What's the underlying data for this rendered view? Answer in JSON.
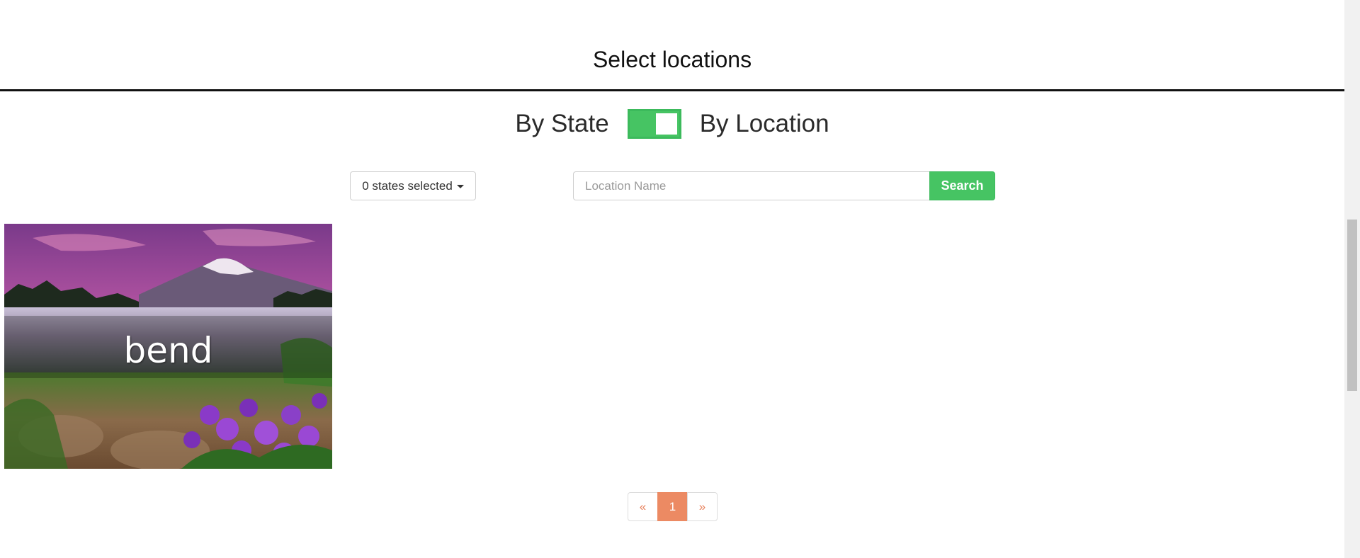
{
  "header": {
    "title": "Select locations"
  },
  "mode_toggle": {
    "left_label": "By State",
    "right_label": "By Location",
    "state": "By Location"
  },
  "filters": {
    "states_dropdown_label": "0 states selected",
    "location_input": {
      "value": "",
      "placeholder": "Location Name"
    },
    "search_label": "Search"
  },
  "results": [
    {
      "label": "bend"
    }
  ],
  "pagination": {
    "prev": "«",
    "current": "1",
    "next": "»"
  },
  "colors": {
    "accent_green": "#46c463",
    "pagination_accent": "#ec8a63"
  },
  "icons": {
    "dropdown": "caret-down-icon"
  }
}
